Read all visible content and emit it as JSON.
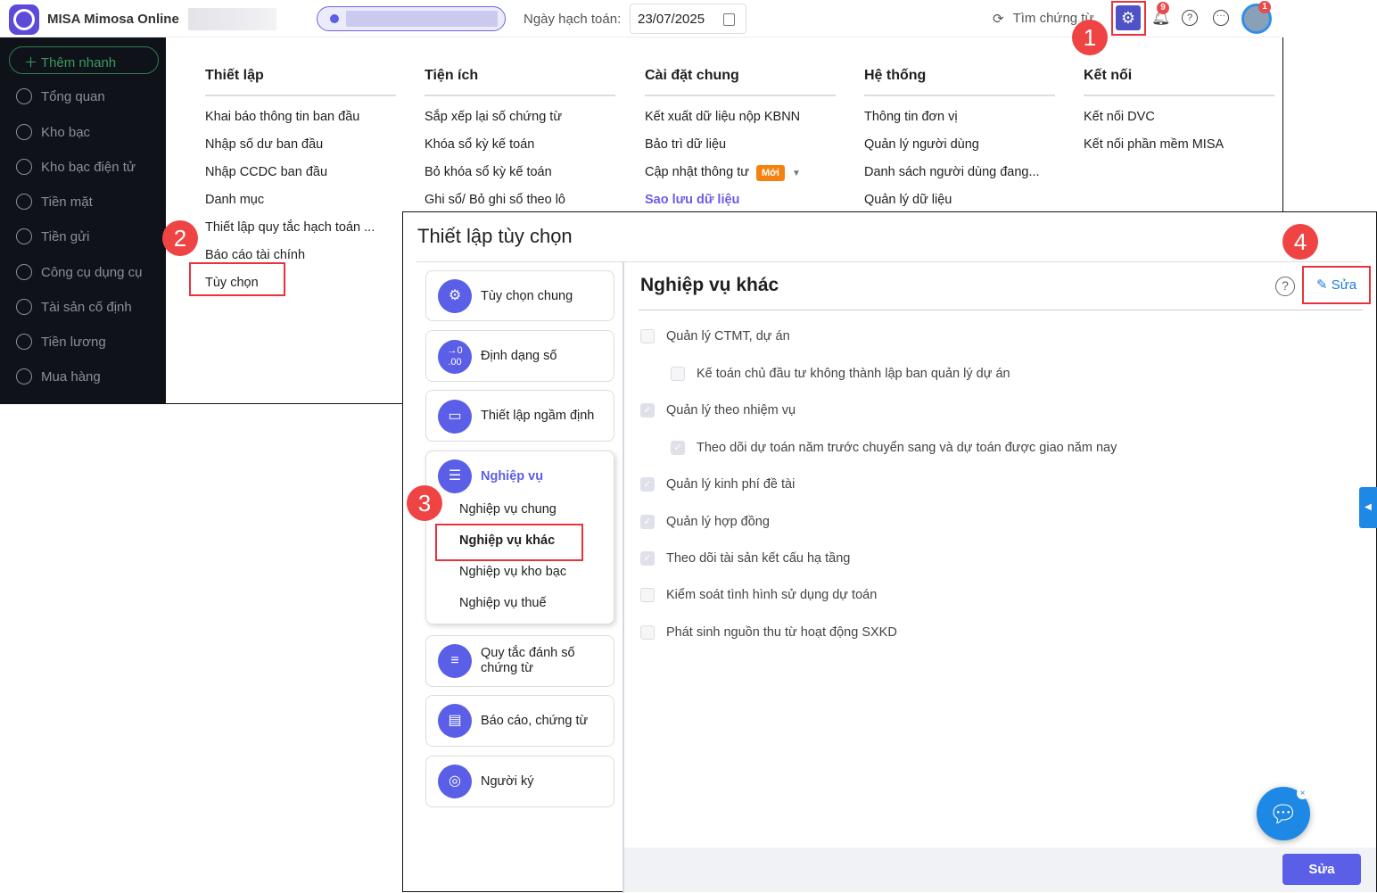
{
  "header": {
    "app_name": "MISA Mimosa Online",
    "date_label": "Ngày hạch toán:",
    "date_value": "23/07/2025",
    "search_label": "Tìm chứng từ",
    "notification_count": "9",
    "avatar_badge": "1"
  },
  "sidebar": {
    "quick_add": "Thêm nhanh",
    "items": [
      {
        "label": "Tổng quan"
      },
      {
        "label": "Kho bạc"
      },
      {
        "label": "Kho bạc điện tử"
      },
      {
        "label": "Tiền mặt"
      },
      {
        "label": "Tiền gửi"
      },
      {
        "label": "Công cụ dụng cụ"
      },
      {
        "label": "Tài sản cố định"
      },
      {
        "label": "Tiền lương"
      },
      {
        "label": "Mua hàng"
      }
    ]
  },
  "menu": {
    "columns": [
      {
        "title": "Thiết lập",
        "items": [
          "Khai báo thông tin ban đầu",
          "Nhập số dư ban đầu",
          "Nhập CCDC ban đầu",
          "Danh mục",
          "Thiết lập quy tắc hạch toán ...",
          "Báo cáo tài chính",
          "Tùy chọn"
        ]
      },
      {
        "title": "Tiện ích",
        "items": [
          "Sắp xếp lại số chứng từ",
          "Khóa sổ kỳ kế toán",
          "Bỏ khóa sổ kỳ kế toán",
          "Ghi sổ/ Bỏ ghi sổ theo lô"
        ]
      },
      {
        "title": "Cài đặt chung",
        "items": [
          "Kết xuất dữ liệu nộp KBNN",
          "Bảo trì dữ liệu",
          "Cập nhật thông tư",
          "Sao lưu dữ liệu"
        ],
        "new_badge": "Mới"
      },
      {
        "title": "Hệ thống",
        "items": [
          "Thông tin đơn vị",
          "Quản lý người dùng",
          "Danh sách người dùng đang...",
          "Quản lý dữ liệu"
        ]
      },
      {
        "title": "Kết nối",
        "items": [
          "Kết nối DVC",
          "Kết nối phần mềm MISA"
        ]
      }
    ]
  },
  "markers": [
    "1",
    "2",
    "3",
    "4"
  ],
  "dialog": {
    "title": "Thiết lập tùy chọn",
    "nav": [
      {
        "label": "Tùy chọn chung"
      },
      {
        "label": "Định dạng số"
      },
      {
        "label": "Thiết lập ngầm định"
      },
      {
        "label": "Nghiệp vụ",
        "children": [
          "Nghiệp vụ chung",
          "Nghiệp vụ khác",
          "Nghiệp vụ kho bạc",
          "Nghiệp vụ thuế"
        ]
      },
      {
        "label": "Quy tắc đánh số chứng từ"
      },
      {
        "label": "Báo cáo, chứng từ"
      },
      {
        "label": "Người ký"
      }
    ],
    "content_title": "Nghiệp vụ khác",
    "edit_link": "Sửa",
    "save_button": "Sửa",
    "options": [
      {
        "label": "Quản lý CTMT, dự án",
        "checked": false
      },
      {
        "label": "Kế toán chủ đầu tư không thành lập ban quản lý dự án",
        "checked": false
      },
      {
        "label": "Quản lý theo nhiệm vụ",
        "checked": true
      },
      {
        "label": "Theo dõi dự toán năm trước chuyển sang và dự toán được giao năm nay",
        "checked": true
      },
      {
        "label": "Quản lý kinh phí đề tài",
        "checked": true
      },
      {
        "label": "Quản lý hợp đồng",
        "checked": true
      },
      {
        "label": "Theo dõi tài sản kết cấu hạ tầng",
        "checked": true
      },
      {
        "label": "Kiểm soát tình hình sử dụng dự toán",
        "checked": false
      },
      {
        "label": "Phát sinh nguồn thu từ hoạt động SXKD",
        "checked": false
      }
    ]
  },
  "colors": {
    "accent": "#5b5fe8",
    "marker": "#ef4444",
    "sidebar_bg": "#10121a",
    "link": "#1e88e5"
  }
}
